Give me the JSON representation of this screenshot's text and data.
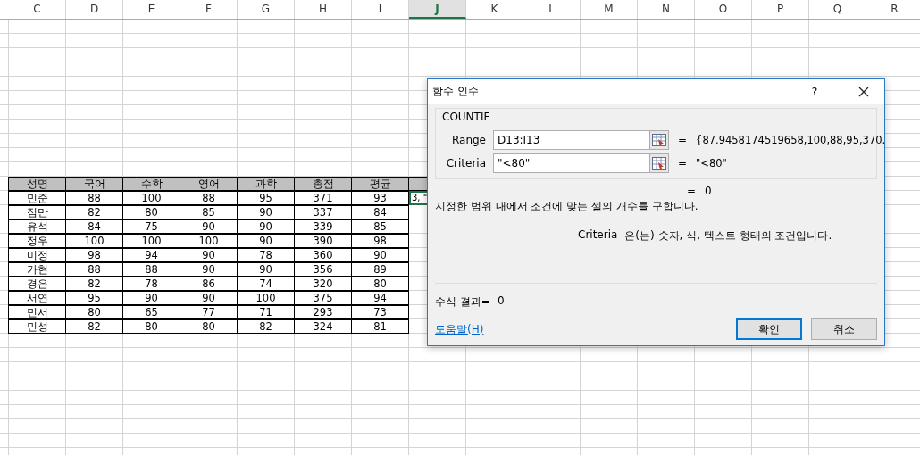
{
  "sheet": {
    "columns": [
      {
        "label": "C",
        "selected": false
      },
      {
        "label": "D",
        "selected": false
      },
      {
        "label": "E",
        "selected": false
      },
      {
        "label": "F",
        "selected": false
      },
      {
        "label": "G",
        "selected": false
      },
      {
        "label": "H",
        "selected": false
      },
      {
        "label": "I",
        "selected": false
      },
      {
        "label": "J",
        "selected": true
      },
      {
        "label": "K",
        "selected": false
      },
      {
        "label": "L",
        "selected": false
      },
      {
        "label": "M",
        "selected": false
      },
      {
        "label": "N",
        "selected": false
      },
      {
        "label": "O",
        "selected": false
      },
      {
        "label": "P",
        "selected": false
      },
      {
        "label": "Q",
        "selected": false
      },
      {
        "label": "R",
        "selected": false
      }
    ],
    "table": {
      "headers": [
        "성명",
        "국어",
        "수학",
        "영어",
        "과학",
        "총점",
        "평균"
      ],
      "rows": [
        [
          "민준",
          "88",
          "100",
          "88",
          "95",
          "371",
          "93"
        ],
        [
          "점만",
          "82",
          "80",
          "85",
          "90",
          "337",
          "84"
        ],
        [
          "유석",
          "84",
          "75",
          "90",
          "90",
          "339",
          "85"
        ],
        [
          "정우",
          "100",
          "100",
          "100",
          "90",
          "390",
          "98"
        ],
        [
          "미정",
          "98",
          "94",
          "90",
          "78",
          "360",
          "90"
        ],
        [
          "가현",
          "88",
          "88",
          "90",
          "90",
          "356",
          "89"
        ],
        [
          "경은",
          "82",
          "78",
          "86",
          "74",
          "320",
          "80"
        ],
        [
          "서연",
          "95",
          "90",
          "90",
          "100",
          "375",
          "94"
        ],
        [
          "민서",
          "80",
          "65",
          "77",
          "71",
          "293",
          "73"
        ],
        [
          "민성",
          "82",
          "80",
          "80",
          "82",
          "324",
          "81"
        ]
      ]
    },
    "active_cell": {
      "value": "3, \""
    }
  },
  "dialog": {
    "title": "함수 인수",
    "help": "?",
    "function_name": "COUNTIF",
    "arguments": [
      {
        "label": "Range",
        "value": "D13:I13",
        "equals": "=",
        "result": "{87.9458174519658,100,88,95,370."
      },
      {
        "label": "Criteria",
        "value": "\"<80\"",
        "equals": "=",
        "result": "\"<80\""
      }
    ],
    "function_result": {
      "equals": "=",
      "value": "0"
    },
    "description": "지정한 범위 내에서 조건에 맞는 셀의 개수를 구합니다.",
    "argument_help": {
      "name": "Criteria",
      "text": "은(는) 숫자, 식, 텍스트 형태의 조건입니다."
    },
    "formula_result": {
      "label": "수식 결과=",
      "value": "0"
    },
    "help_link": "도움말(H)",
    "buttons": [
      {
        "label": "확인",
        "default": true
      },
      {
        "label": "취소",
        "default": false
      }
    ]
  }
}
